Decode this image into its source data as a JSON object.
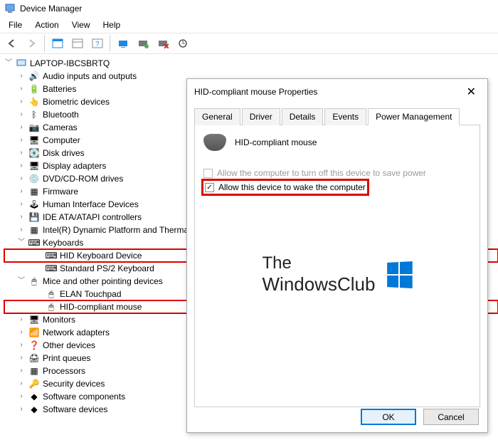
{
  "window": {
    "title": "Device Manager"
  },
  "menu": {
    "file": "File",
    "action": "Action",
    "view": "View",
    "help": "Help"
  },
  "root": "LAPTOP-IBCSBRTQ",
  "categories": [
    "Audio inputs and outputs",
    "Batteries",
    "Biometric devices",
    "Bluetooth",
    "Cameras",
    "Computer",
    "Disk drives",
    "Display adapters",
    "DVD/CD-ROM drives",
    "Firmware",
    "Human Interface Devices",
    "IDE ATA/ATAPI controllers",
    "Intel(R) Dynamic Platform and Thermal Framework",
    "Keyboards",
    "Mice and other pointing devices",
    "Monitors",
    "Network adapters",
    "Other devices",
    "Print queues",
    "Processors",
    "Security devices",
    "Software components",
    "Software devices"
  ],
  "keyboards": {
    "hid": "HID Keyboard Device",
    "ps2": "Standard PS/2 Keyboard"
  },
  "mice": {
    "elan": "ELAN Touchpad",
    "hid": "HID-compliant mouse"
  },
  "dialog": {
    "title": "HID-compliant mouse Properties",
    "tabs": {
      "general": "General",
      "driver": "Driver",
      "details": "Details",
      "events": "Events",
      "power": "Power Management"
    },
    "device_name": "HID-compliant mouse",
    "opt_turnoff": "Allow the computer to turn off this device to save power",
    "opt_wake": "Allow this device to wake the computer",
    "ok": "OK",
    "cancel": "Cancel"
  },
  "watermark": {
    "line1": "The",
    "line2": "WindowsClub"
  }
}
